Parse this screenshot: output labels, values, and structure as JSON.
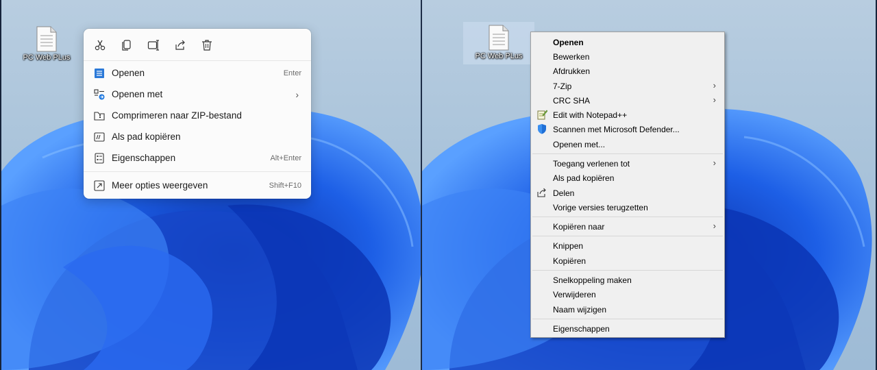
{
  "desktop_icon_label": "PC Web PLus",
  "modern_menu": {
    "quick_actions": [
      {
        "name": "cut-icon"
      },
      {
        "name": "copy-icon"
      },
      {
        "name": "rename-icon"
      },
      {
        "name": "share-icon"
      },
      {
        "name": "delete-icon"
      }
    ],
    "items": [
      {
        "label": "Openen",
        "shortcut": "Enter",
        "icon": "open-icon"
      },
      {
        "label": "Openen met",
        "shortcut": "",
        "icon": "open-with-icon",
        "submenu": true
      },
      {
        "label": "Comprimeren naar ZIP-bestand",
        "shortcut": "",
        "icon": "zip-icon"
      },
      {
        "label": "Als pad kopiëren",
        "shortcut": "",
        "icon": "copy-path-icon"
      },
      {
        "label": "Eigenschappen",
        "shortcut": "Alt+Enter",
        "icon": "properties-icon"
      },
      {
        "label": "Meer opties weergeven",
        "shortcut": "Shift+F10",
        "icon": "more-options-icon"
      }
    ]
  },
  "classic_menu": {
    "items": [
      {
        "label": "Openen",
        "bold": true
      },
      {
        "label": "Bewerken"
      },
      {
        "label": "Afdrukken"
      },
      {
        "label": "7-Zip",
        "submenu": true
      },
      {
        "label": "CRC SHA",
        "submenu": true
      },
      {
        "label": "Edit with Notepad++",
        "icon": "notepad-plus-plus-icon"
      },
      {
        "label": "Scannen met Microsoft Defender...",
        "icon": "defender-shield-icon"
      },
      {
        "label": "Openen met..."
      },
      {
        "label": "Toegang verlenen tot",
        "submenu": true
      },
      {
        "label": "Als pad kopiëren"
      },
      {
        "label": "Delen",
        "icon": "share-icon"
      },
      {
        "label": "Vorige versies terugzetten"
      },
      {
        "label": "Kopiëren naar",
        "submenu": true
      },
      {
        "label": "Knippen"
      },
      {
        "label": "Kopiëren"
      },
      {
        "label": "Snelkoppeling maken"
      },
      {
        "label": "Verwijderen"
      },
      {
        "label": "Naam wijzigen"
      },
      {
        "label": "Eigenschappen"
      }
    ]
  },
  "colors": {
    "wallpaper_sky": "#a9c3da",
    "bloom_blue": "#1f5fe0",
    "accent": "#0067c0"
  }
}
